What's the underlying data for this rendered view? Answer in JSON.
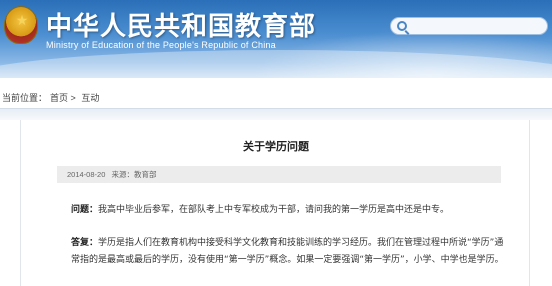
{
  "header": {
    "title_cn": "中华人民共和国教育部",
    "title_en": "Ministry of Education of the People's Republic of China"
  },
  "breadcrumb": {
    "prefix": "当前位置：",
    "items": [
      "首页",
      "互动"
    ],
    "separator": ">"
  },
  "article": {
    "title": "关于学历问题",
    "date": "2014-08-20",
    "source": "来源：教育部",
    "question_label": "问题：",
    "question_text": "我高中毕业后参军，在部队考上中专军校成为干部，请问我的第一学历是高中还是中专。",
    "answer_label": "答复：",
    "answer_text": "学历是指人们在教育机构中接受科学文化教育和技能训练的学习经历。我们在管理过程中所说“学历”通常指的是最高或最后的学历，没有使用“第一学历”概念。如果一定要强调“第一学历”，小学、中学也是学历。"
  },
  "colors": {
    "header_top": "#2a6fb8",
    "header_bottom": "#c9def3",
    "meta_bg": "#ececec"
  },
  "icons": {
    "emblem": "national-emblem-icon",
    "search": "search-icon"
  }
}
